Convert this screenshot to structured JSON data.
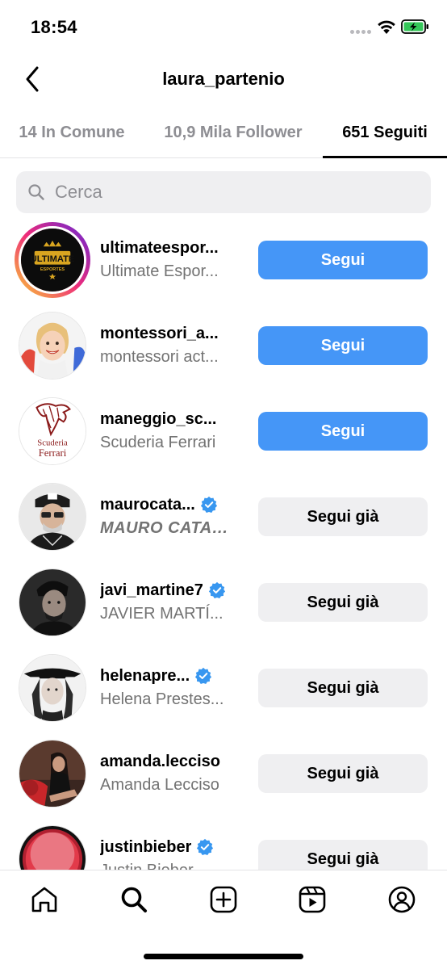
{
  "status_bar": {
    "time": "18:54"
  },
  "header": {
    "title": "laura_partenio"
  },
  "tabs": [
    {
      "label": "14 In Comune"
    },
    {
      "label": "10,9 Mila Follower"
    },
    {
      "label": "651 Seguiti"
    }
  ],
  "search": {
    "placeholder": "Cerca"
  },
  "users": [
    {
      "username": "ultimateespor...",
      "full_name": "Ultimate Espor...",
      "verified": false,
      "button": "Segui"
    },
    {
      "username": "montessori_a...",
      "full_name": "montessori act...",
      "verified": false,
      "button": "Segui"
    },
    {
      "username": "maneggio_sc...",
      "full_name": "Scuderia Ferrari",
      "verified": false,
      "button": "Segui"
    },
    {
      "username": "maurocata...",
      "full_name": "MAURO CATALI...",
      "verified": true,
      "button": "Segui già"
    },
    {
      "username": "javi_martine7",
      "full_name": "JAVIER MARTÍ...",
      "verified": true,
      "button": "Segui già"
    },
    {
      "username": "helenapre...",
      "full_name": "Helena Prestes...",
      "verified": true,
      "button": "Segui già"
    },
    {
      "username": "amanda.lecciso",
      "full_name": "Amanda Lecciso",
      "verified": false,
      "button": "Segui già"
    },
    {
      "username": "justinbieber",
      "full_name": "Justin Bieber",
      "verified": true,
      "button": "Segui già"
    }
  ],
  "avatars": {
    "ultimate_logo_text": "ULTIMATE",
    "ultimate_logo_sub": "ESPORTES",
    "scuderia_text_1": "Scuderia",
    "scuderia_text_2": "Ferrari"
  },
  "colors": {
    "follow_button": "#4596f7",
    "following_button": "#efeff1",
    "verified_badge": "#3897f0",
    "secondary_text": "#737373"
  },
  "icons": {
    "tabbar": [
      "home-icon",
      "search-icon",
      "create-icon",
      "reels-icon",
      "profile-icon"
    ]
  }
}
